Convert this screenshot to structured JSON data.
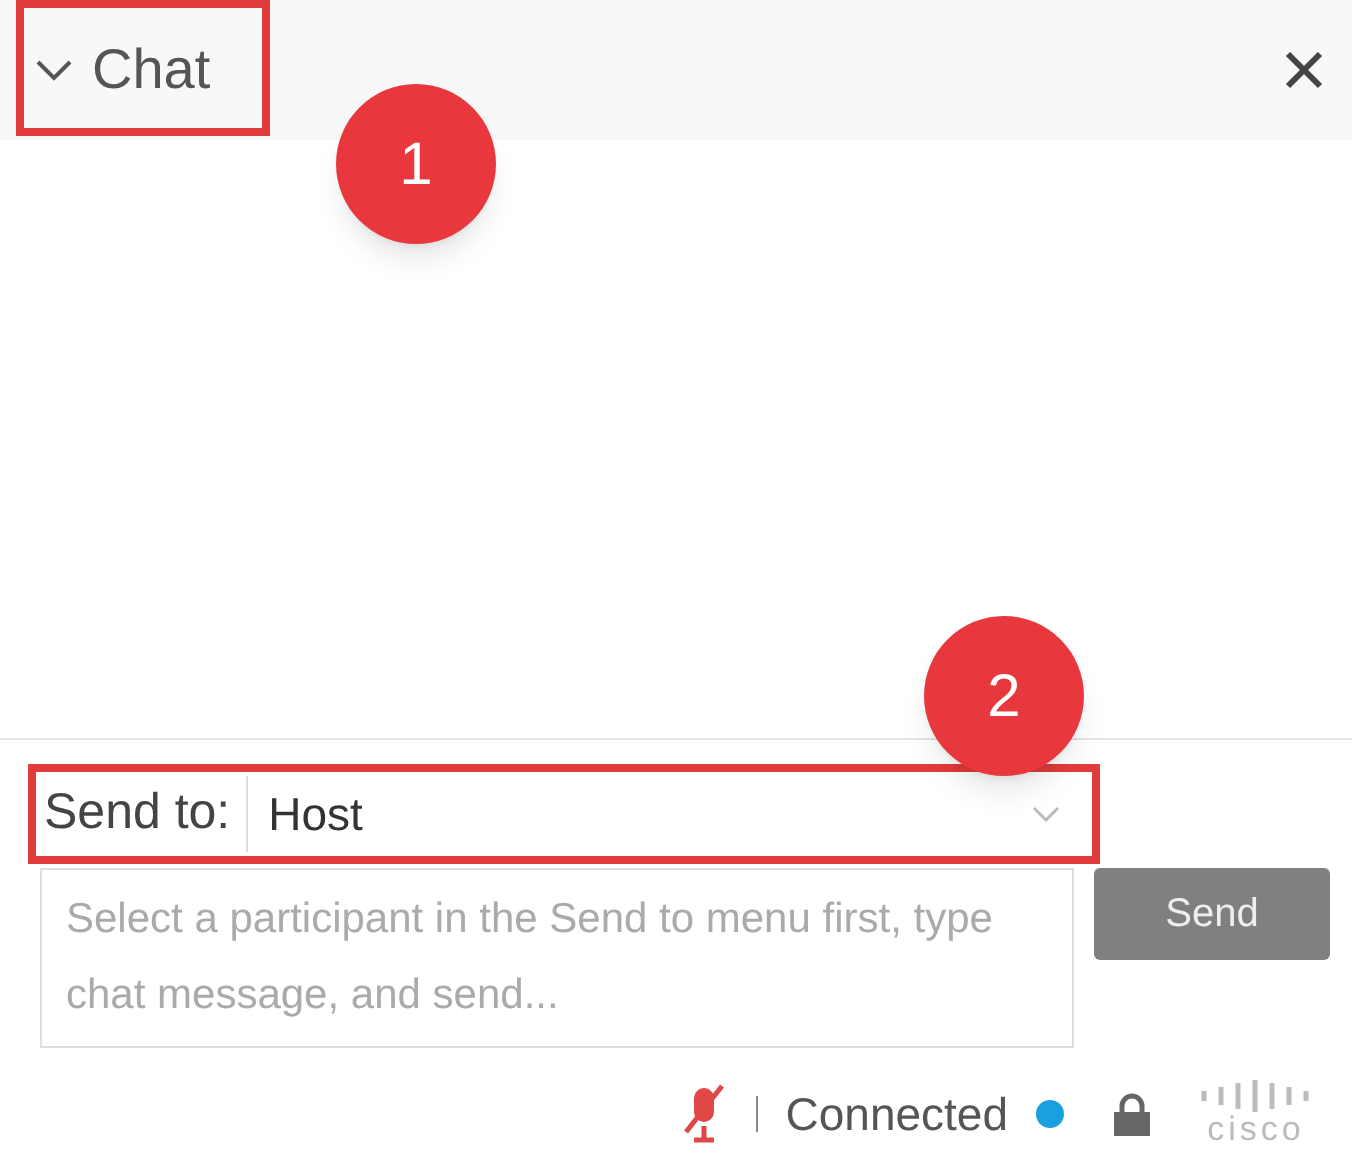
{
  "panel": {
    "title": "Chat",
    "expanded": true
  },
  "send_to": {
    "label": "Send to:",
    "value": "Host"
  },
  "message": {
    "placeholder": "Select a participant in the Send to menu first, type chat message, and send..."
  },
  "send_button": {
    "label": "Send",
    "disabled": true
  },
  "status_bar": {
    "muted": true,
    "status": "Connected",
    "status_dot": {
      "color": "#1a9fe0"
    },
    "logo_text": "cisco"
  },
  "annotations": [
    {
      "label": "1"
    },
    {
      "label": "2"
    }
  ]
}
